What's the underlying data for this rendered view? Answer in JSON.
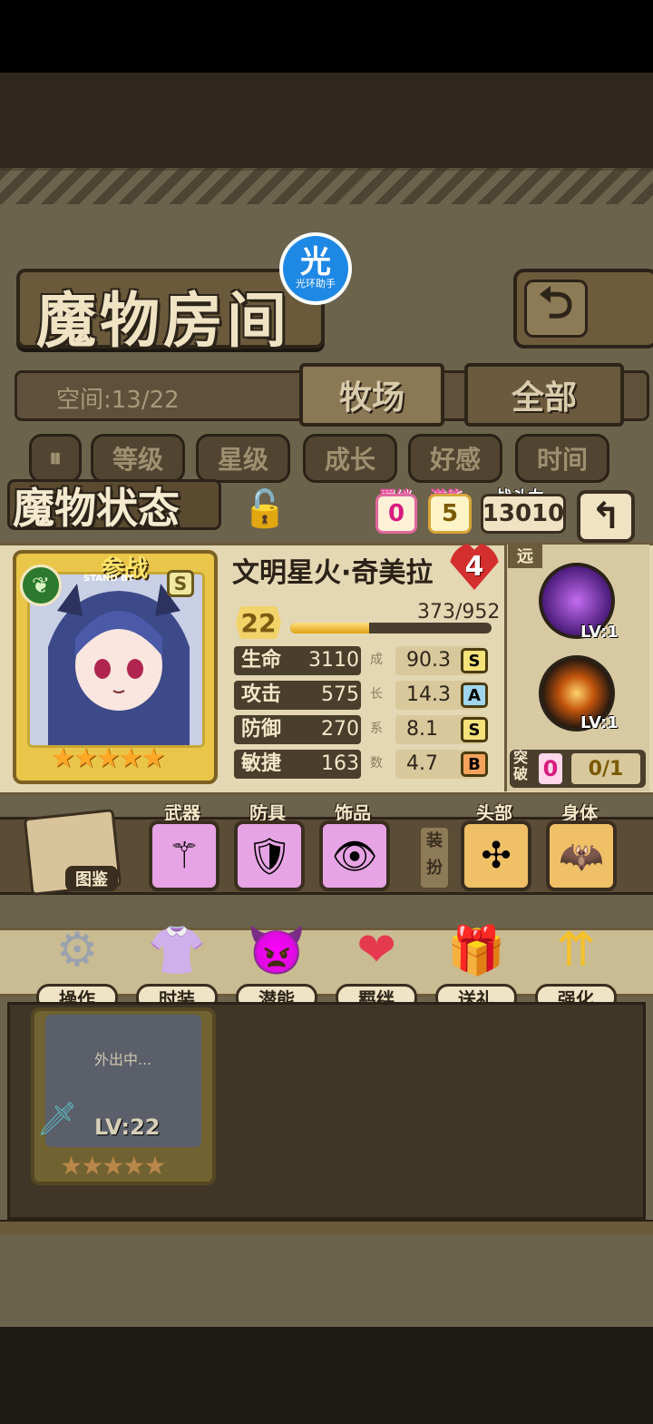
{
  "header": {
    "title": "魔物房间",
    "logo_big": "光",
    "logo_small": "光环助手",
    "back_icon": "back-arrow-icon"
  },
  "space": {
    "label": "空间:13/22"
  },
  "tabs": [
    {
      "label": "牧场",
      "active": true
    },
    {
      "label": "全部",
      "active": false
    }
  ],
  "sort": {
    "toggle": "⏸",
    "options": [
      "等级",
      "星级",
      "成长",
      "好感",
      "时间"
    ]
  },
  "status": {
    "title": "魔物状态",
    "bond_label": "羁绊",
    "bond_value": "0",
    "potential_label": "潜能",
    "potential_value": "5",
    "power_label": "战斗力",
    "power_value": "13010"
  },
  "monster": {
    "name": "文明星火·奇美拉",
    "affinity": "4",
    "standby": "参战",
    "standby_sub": "STAND BY",
    "rank": "S",
    "stars": "★★★★★",
    "level": "22",
    "exp": "373/952",
    "exp_progress": 0.39,
    "growth_label": [
      "成",
      "长",
      "系",
      "数"
    ],
    "stats": [
      {
        "name": "生命",
        "value": "3110",
        "growth": "90.3",
        "grade": "S",
        "grade_color": "#f6e27a"
      },
      {
        "name": "攻击",
        "value": "575",
        "growth": "14.3",
        "grade": "A",
        "grade_color": "#9fd6ee"
      },
      {
        "name": "防御",
        "value": "270",
        "growth": "8.1",
        "grade": "S",
        "grade_color": "#f6e27a"
      },
      {
        "name": "敏捷",
        "value": "163",
        "growth": "4.7",
        "grade": "B",
        "grade_color": "#f5a35c"
      }
    ]
  },
  "skills": {
    "range_label": "远",
    "items": [
      {
        "lv": "LV:1"
      },
      {
        "lv": "LV:1"
      }
    ],
    "break_label": "突破",
    "break_value": "0",
    "break_ratio": "0/1"
  },
  "equipment": {
    "book_label": "图鉴",
    "slots": [
      {
        "label": "武器"
      },
      {
        "label": "防具"
      },
      {
        "label": "饰品"
      },
      {
        "label": "头部"
      },
      {
        "label": "身体"
      }
    ],
    "dress_label": "装扮"
  },
  "actions": [
    {
      "label": "操作"
    },
    {
      "label": "时装"
    },
    {
      "label": "潜能"
    },
    {
      "label": "羁绊"
    },
    {
      "label": "送礼"
    },
    {
      "label": "强化"
    }
  ],
  "list": {
    "away_text": "外出中...",
    "level": "LV:22",
    "stars": "★★★★★"
  }
}
